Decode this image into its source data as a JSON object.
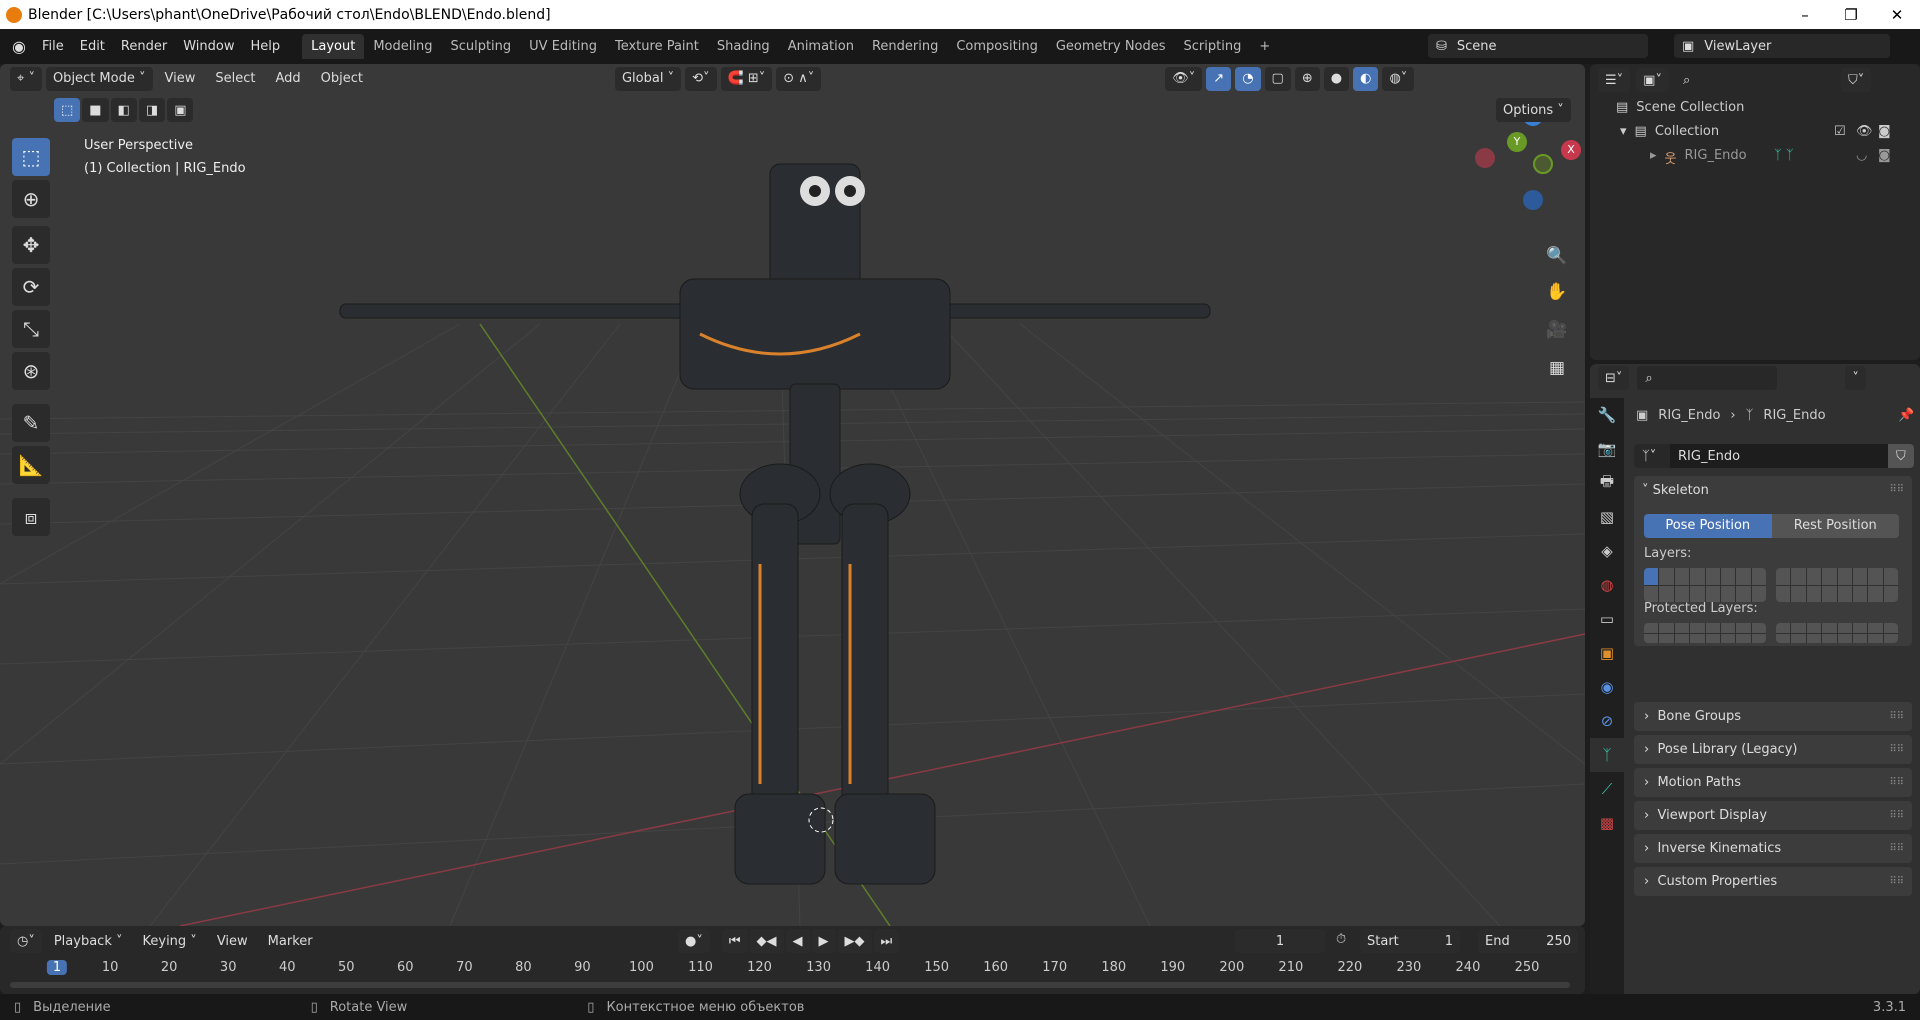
{
  "window": {
    "title": "Blender [C:\\Users\\phant\\OneDrive\\Рабочий стол\\Endo\\BLEND\\Endo.blend]",
    "min": "–",
    "max": "❐",
    "close": "✕"
  },
  "menu": [
    "File",
    "Edit",
    "Render",
    "Window",
    "Help"
  ],
  "workspaces": [
    "Layout",
    "Modeling",
    "Sculpting",
    "UV Editing",
    "Texture Paint",
    "Shading",
    "Animation",
    "Rendering",
    "Compositing",
    "Geometry Nodes",
    "Scripting"
  ],
  "add_workspace": "+",
  "scene": "Scene",
  "view_layer": "ViewLayer",
  "viewport": {
    "mode": "Object Mode",
    "menus": [
      "View",
      "Select",
      "Add",
      "Object"
    ],
    "orientation": "Global",
    "options": "Options",
    "perspective": "User Perspective",
    "collection_info": "(1) Collection | RIG_Endo",
    "gizmo": {
      "z": "Z",
      "y": "Y",
      "x": "X"
    }
  },
  "outliner": {
    "scene_collection": "Scene Collection",
    "collection": "Collection",
    "object": "RIG_Endo"
  },
  "properties": {
    "breadcrumb_obj": "RIG_Endo",
    "breadcrumb_data": "RIG_Endo",
    "data_name": "RIG_Endo",
    "skeleton": "Skeleton",
    "pose_position": "Pose Position",
    "rest_position": "Rest Position",
    "layers": "Layers:",
    "protected_layers": "Protected Layers:",
    "panels": [
      "Bone Groups",
      "Pose Library (Legacy)",
      "Motion Paths",
      "Viewport Display",
      "Inverse Kinematics",
      "Custom Properties"
    ]
  },
  "timeline": {
    "menus": [
      "Playback",
      "Keying",
      "View",
      "Marker"
    ],
    "current_frame": "1",
    "start_label": "Start",
    "start": "1",
    "end_label": "End",
    "end": "250",
    "ticks": [
      "1",
      "10",
      "20",
      "30",
      "40",
      "50",
      "60",
      "70",
      "80",
      "90",
      "100",
      "110",
      "120",
      "130",
      "140",
      "150",
      "160",
      "170",
      "180",
      "190",
      "200",
      "210",
      "220",
      "230",
      "240",
      "250"
    ]
  },
  "status": {
    "select": "Выделение",
    "rotate": "Rotate View",
    "context": "Контекстное меню объектов",
    "version": "3.3.1"
  },
  "colors": {
    "accent": "#4772b3",
    "x_axis": "#c8384c",
    "y_axis": "#6a9a26",
    "z_axis": "#3a7fd6"
  }
}
